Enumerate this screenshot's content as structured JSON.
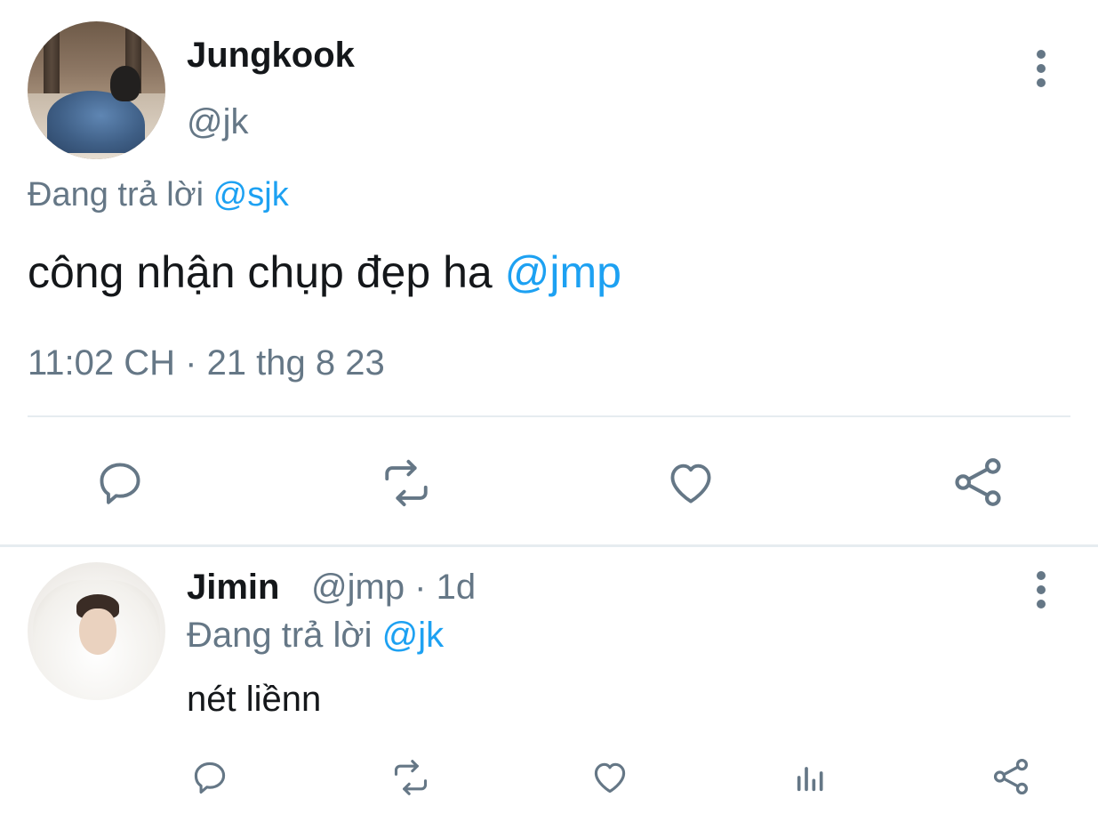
{
  "main_tweet": {
    "author": {
      "name": "Jungkook",
      "handle": "@jk"
    },
    "replying_prefix": "Đang trả lời",
    "replying_to": "@sjk",
    "text": "công nhận chụp đẹp ha",
    "text_mention": "@jmp",
    "timestamp": "11:02 CH · 21 thg 8 23",
    "actions": [
      "reply-icon",
      "retweet-icon",
      "like-icon",
      "share-icon"
    ]
  },
  "reply_tweet": {
    "author": {
      "name": "Jimin",
      "handle": "@jmp · 1d"
    },
    "replying_prefix": "Đang trả lời",
    "replying_to": "@jk",
    "text": "nét liềnn",
    "actions": [
      "reply-icon",
      "retweet-icon",
      "like-icon",
      "analytics-icon",
      "share-icon"
    ]
  },
  "colors": {
    "accent": "#1da1f2",
    "text": "#14171a",
    "muted": "#657786",
    "divider": "#e6ecf0"
  }
}
